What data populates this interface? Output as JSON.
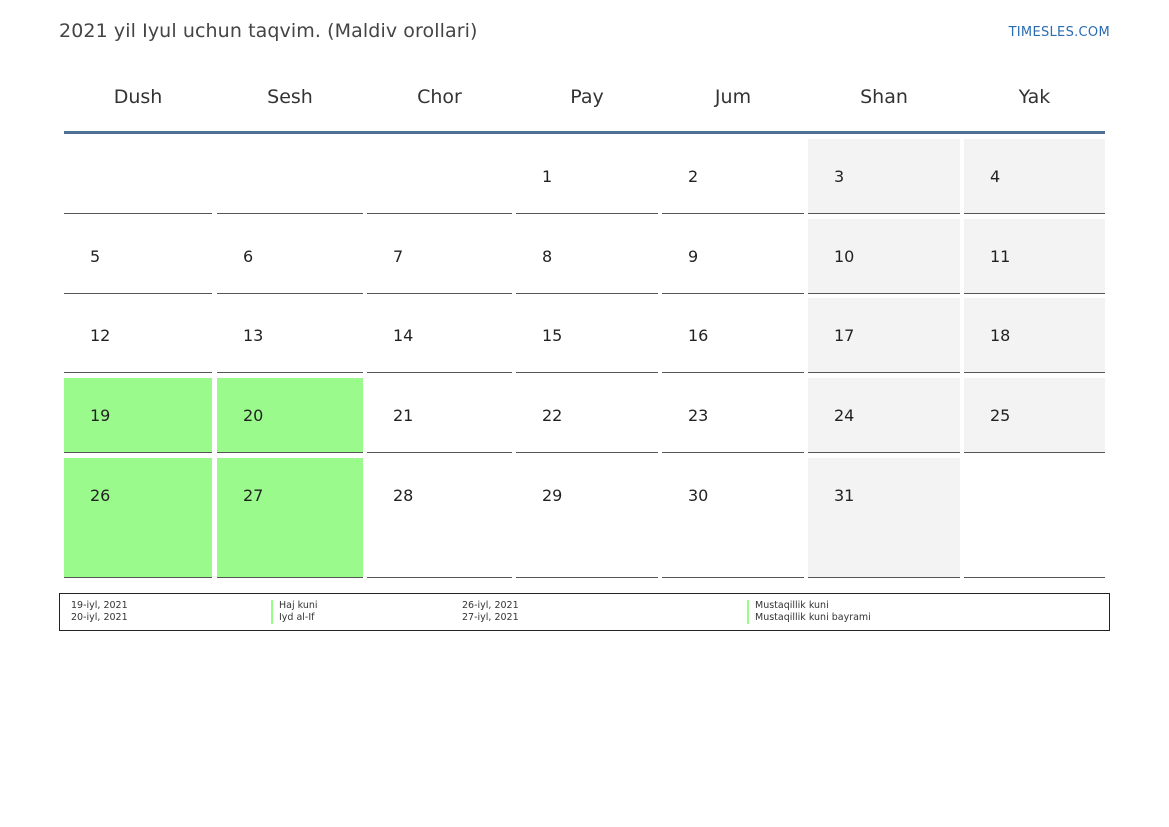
{
  "page": {
    "title": "2021 yil Iyul uchun taqvim. (Maldiv orollari)",
    "brand": "TIMESLES.COM"
  },
  "weekdays": [
    "Dush",
    "Sesh",
    "Chor",
    "Pay",
    "Jum",
    "Shan",
    "Yak"
  ],
  "weeks": [
    [
      null,
      null,
      null,
      "1",
      "2",
      "3",
      "4"
    ],
    [
      "5",
      "6",
      "7",
      "8",
      "9",
      "10",
      "11"
    ],
    [
      "12",
      "13",
      "14",
      "15",
      "16",
      "17",
      "18"
    ],
    [
      "19",
      "20",
      "21",
      "22",
      "23",
      "24",
      "25"
    ],
    [
      "26",
      "27",
      "28",
      "29",
      "30",
      "31",
      null
    ]
  ],
  "holiday_days": [
    "19",
    "20",
    "26",
    "27"
  ],
  "colors": {
    "holiday": "#9afa8c",
    "weekend": "#f3f3f3",
    "header_rule": "#4f6f93",
    "brand": "#2b6cb0"
  },
  "legend": {
    "left_dates": [
      "19-iyl, 2021",
      "20-iyl, 2021"
    ],
    "left_names": [
      "Haj kuni",
      "Iyd al-If"
    ],
    "right_dates": [
      "26-iyl, 2021",
      "27-iyl, 2021"
    ],
    "right_names": [
      "Mustaqillik kuni",
      "Mustaqillik kuni bayrami"
    ]
  }
}
